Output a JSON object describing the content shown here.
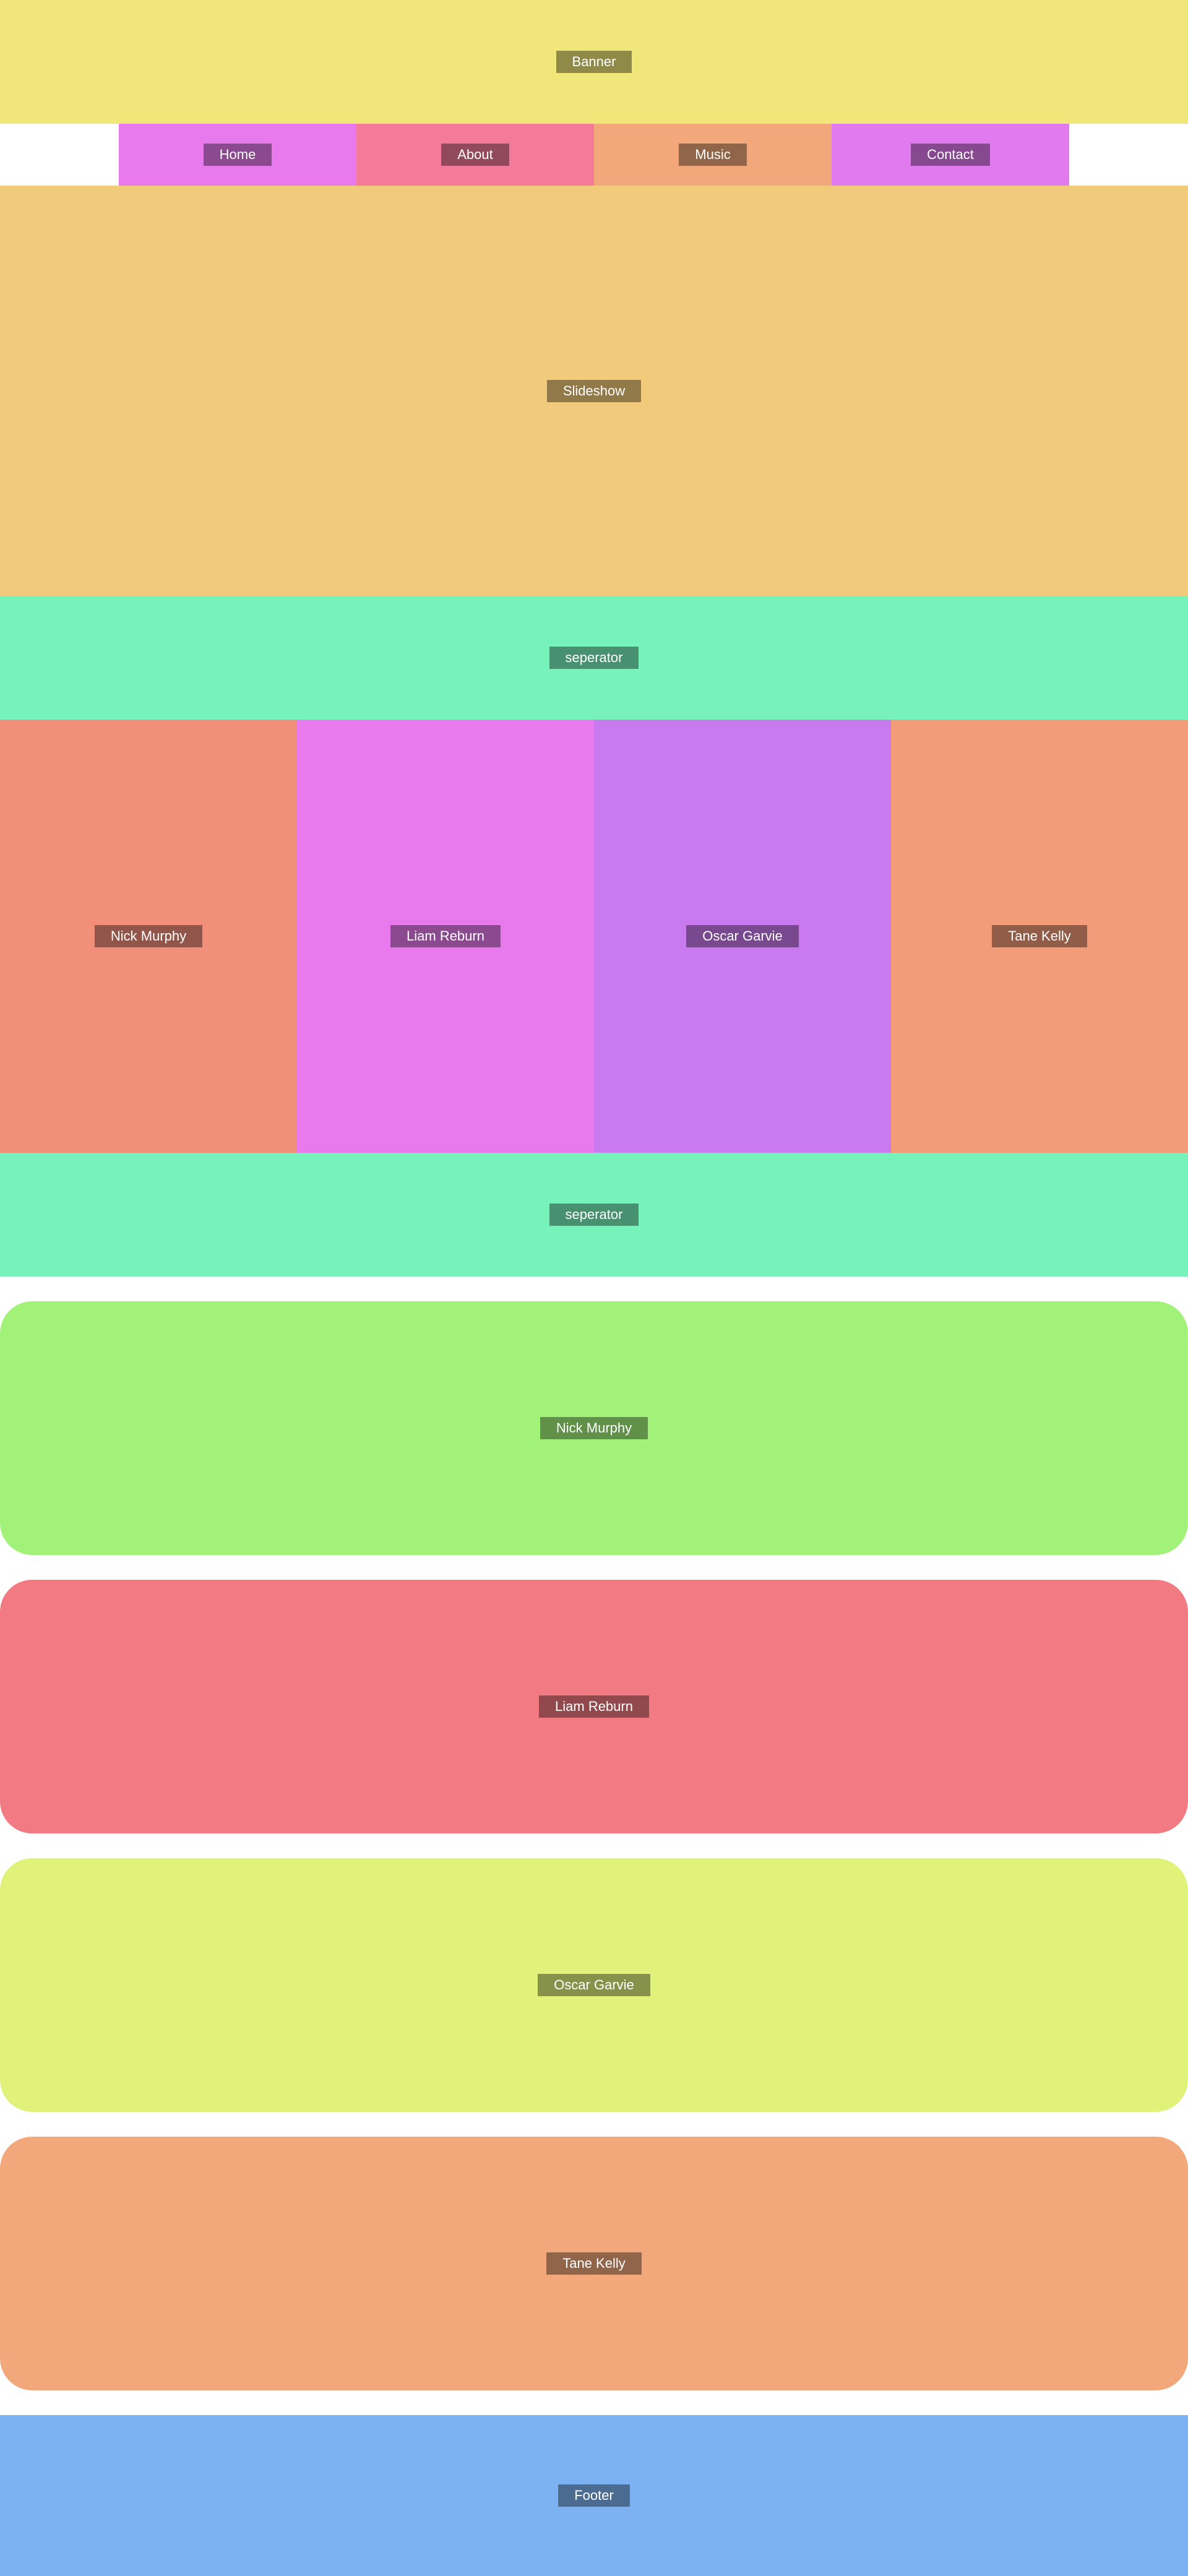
{
  "colors": {
    "banner": "#f0e67a",
    "slideshow": "#f2ca7c",
    "separator": "#77f2bb",
    "footer": "#7db2f2"
  },
  "banner": {
    "label": "Banner"
  },
  "nav": {
    "items": [
      {
        "label": "Home",
        "color": "#e87aee"
      },
      {
        "label": "About",
        "color": "#f47a9a"
      },
      {
        "label": "Music",
        "color": "#f2a87a"
      },
      {
        "label": "Contact",
        "color": "#e07aee"
      }
    ]
  },
  "slideshow": {
    "label": "Slideshow"
  },
  "separator_top": {
    "label": "seperator"
  },
  "members": [
    {
      "label": "Nick Murphy",
      "color": "#f28f7a"
    },
    {
      "label": "Liam Reburn",
      "color": "#e87aee"
    },
    {
      "label": "Oscar Garvie",
      "color": "#c87aee"
    },
    {
      "label": "Tane Kelly",
      "color": "#f29c7a"
    }
  ],
  "separator_bottom": {
    "label": "seperator"
  },
  "cards": [
    {
      "label": "Nick Murphy",
      "color": "#a2f27a"
    },
    {
      "label": "Liam Reburn",
      "color": "#f27a82"
    },
    {
      "label": "Oscar Garvie",
      "color": "#e0f27a"
    },
    {
      "label": "Tane Kelly",
      "color": "#f2a87a"
    }
  ],
  "footer": {
    "label": "Footer"
  }
}
